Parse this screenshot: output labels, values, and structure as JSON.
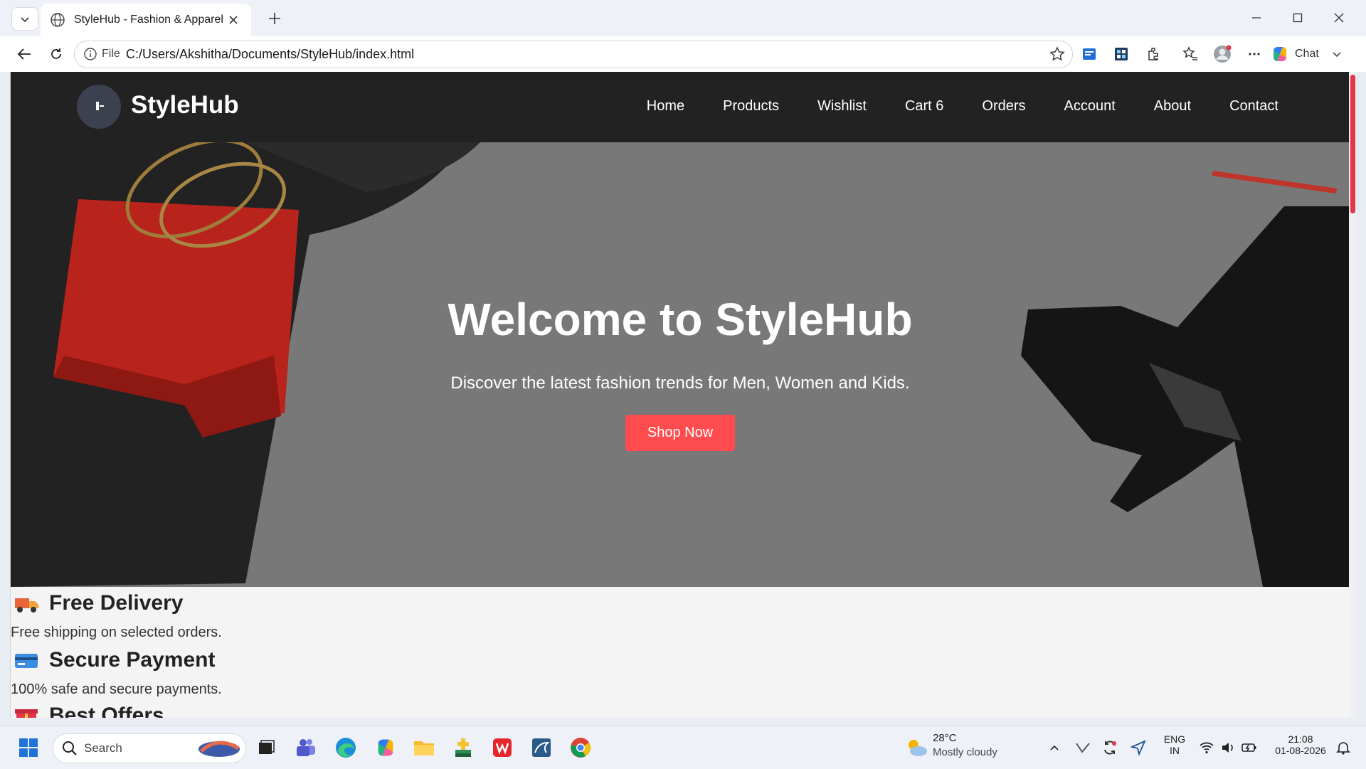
{
  "browser": {
    "tab_title": "StyleHub - Fashion & Apparel",
    "address_prefix": "File",
    "url": "C:/Users/Akshitha/Documents/StyleHub/index.html",
    "chat_label": "Chat"
  },
  "site": {
    "logo_text": "StyleHub",
    "nav": [
      "Home",
      "Products",
      "Wishlist",
      "Cart 6",
      "Orders",
      "Account",
      "About",
      "Contact"
    ],
    "hero": {
      "title": "Welcome to StyleHub",
      "subtitle": "Discover the latest fashion trends for Men, Women and Kids.",
      "button": "Shop Now"
    },
    "features": [
      {
        "icon": "delivery-truck-icon",
        "title": "Free Delivery",
        "desc": "Free shipping on selected orders."
      },
      {
        "icon": "credit-card-icon",
        "title": "Secure Payment",
        "desc": "100% safe and secure payments."
      },
      {
        "icon": "gift-icon",
        "title": "Best Offers",
        "desc": ""
      }
    ],
    "accent_color": "#ff4d4f",
    "nav_bg": "#222222"
  },
  "taskbar": {
    "search_placeholder": "Search",
    "weather_temp": "28°C",
    "weather_desc": "Mostly cloudy",
    "lang_top": "ENG",
    "lang_bottom": "IN",
    "time": "21:08",
    "date": "01-08-2026"
  }
}
